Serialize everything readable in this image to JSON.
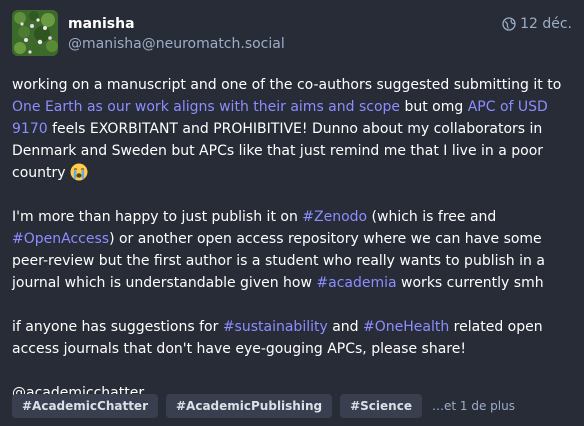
{
  "author": {
    "display_name": "manisha",
    "handle": "@manisha@neuromatch.social",
    "avatar_icon": "plant-photo-avatar"
  },
  "meta": {
    "visibility_icon": "globe-icon",
    "date": "12 déc."
  },
  "body": {
    "p1": {
      "t1": "working on a manuscript and one of the co-authors suggested submitting it to ",
      "link1": "One Earth as our work aligns with their aims and scope",
      "t2": " but omg ",
      "link2": "APC of USD 9170",
      "t3": " feels EXORBITANT and PROHIBITIVE! Dunno about my collaborators in Denmark and Sweden but APCs like that just remind me that I live in a poor country ",
      "emoji": "crying-face-emoji"
    },
    "p2": {
      "t1": "I'm more than happy to just publish it on ",
      "tag1": "#Zenodo",
      "t2": " (which is free and ",
      "tag2": "#OpenAccess",
      "t3": ") or another open access repository where we can have some peer-review but the first author is a student who really wants to publish in a journal which is understandable given how ",
      "tag3": "#academia",
      "t4": " works currently smh"
    },
    "p3": {
      "t1": "if anyone has suggestions for ",
      "tag1": "#sustainability",
      "t2": " and ",
      "tag2": "#OneHealth",
      "t3": " related open access journals that don't have eye-gouging APCs, please share!"
    },
    "p4": {
      "mention": "@academicchatter"
    }
  },
  "hashtag_bar": {
    "tags": [
      "#AcademicChatter",
      "#AcademicPublishing",
      "#Science"
    ],
    "more": "…et 1 de plus"
  },
  "colors": {
    "background": "#282c37",
    "link": "#8c8dff",
    "secondary_text": "#9baec8",
    "tag_bg": "#393f4f"
  }
}
